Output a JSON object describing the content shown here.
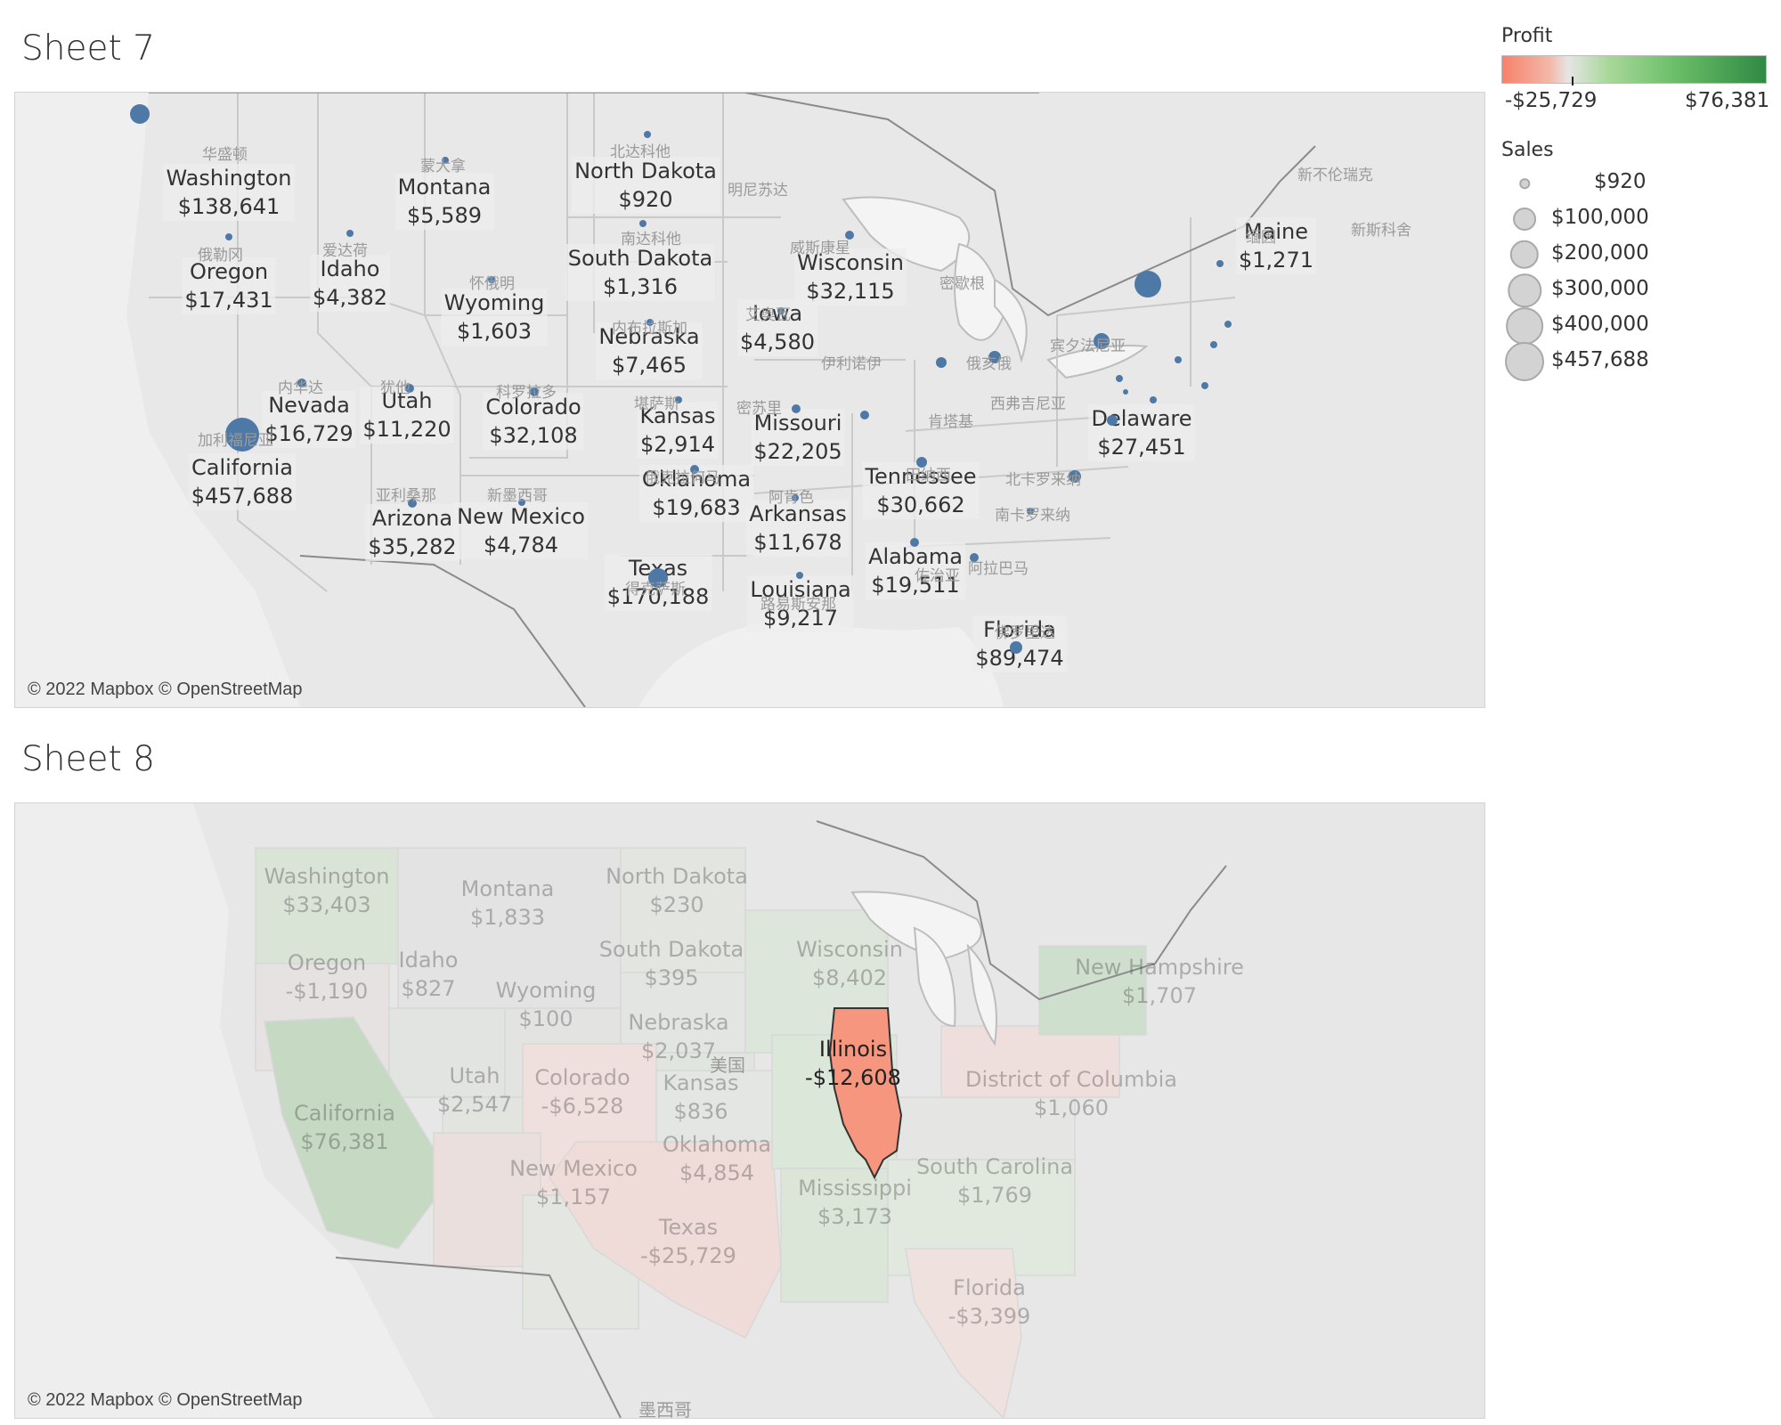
{
  "sheet7": {
    "title": "Sheet 7",
    "attribution": "© 2022 Mapbox © OpenStreetMap",
    "states": [
      {
        "name": "Washington",
        "value": "$138,641"
      },
      {
        "name": "Montana",
        "value": "$5,589"
      },
      {
        "name": "North Dakota",
        "value": "$920"
      },
      {
        "name": "Oregon",
        "value": "$17,431"
      },
      {
        "name": "Idaho",
        "value": "$4,382"
      },
      {
        "name": "South Dakota",
        "value": "$1,316"
      },
      {
        "name": "Wisconsin",
        "value": "$32,115"
      },
      {
        "name": "Maine",
        "value": "$1,271"
      },
      {
        "name": "Wyoming",
        "value": "$1,603"
      },
      {
        "name": "Iowa",
        "value": "$4,580"
      },
      {
        "name": "Nebraska",
        "value": "$7,465"
      },
      {
        "name": "Nevada",
        "value": "$16,729"
      },
      {
        "name": "Utah",
        "value": "$11,220"
      },
      {
        "name": "Colorado",
        "value": "$32,108"
      },
      {
        "name": "Kansas",
        "value": "$2,914"
      },
      {
        "name": "Missouri",
        "value": "$22,205"
      },
      {
        "name": "California",
        "value": "$457,688"
      },
      {
        "name": "Delaware",
        "value": "$27,451"
      },
      {
        "name": "Oklahoma",
        "value": "$19,683"
      },
      {
        "name": "Tennessee",
        "value": "$30,662"
      },
      {
        "name": "Arizona",
        "value": "$35,282"
      },
      {
        "name": "New Mexico",
        "value": "$4,784"
      },
      {
        "name": "Arkansas",
        "value": "$11,678"
      },
      {
        "name": "Alabama",
        "value": "$19,511"
      },
      {
        "name": "Texas",
        "value": "$170,188"
      },
      {
        "name": "Louisiana",
        "value": "$9,217"
      },
      {
        "name": "Florida",
        "value": "$89,474"
      }
    ],
    "cjk_labels": [
      "华盛顿",
      "蒙大拿",
      "北达科他",
      "明尼苏达",
      "俄勒冈",
      "爱达荷",
      "南达科他",
      "威斯康星",
      "密歇根",
      "缅因",
      "怀俄明",
      "艾奥瓦",
      "内布拉斯加",
      "伊利诺伊",
      "俄亥俄",
      "宾夕法尼亚",
      "内华达",
      "犹他",
      "科罗拉多",
      "堪萨斯",
      "密苏里",
      "西弗吉尼亚",
      "肯塔基",
      "加利福尼亚",
      "亚利桑那",
      "新墨西哥",
      "俄克拉何马",
      "阿肯色",
      "田纳西",
      "北卡罗来纳",
      "南卡罗来纳",
      "阿拉巴马",
      "佐治亚",
      "得克萨斯",
      "路易斯安那",
      "佛罗里达",
      "新不伦瑞克",
      "新斯科舍"
    ]
  },
  "sheet8": {
    "title": "Sheet 8",
    "attribution": "© 2022 Mapbox © OpenStreetMap",
    "states": [
      {
        "name": "Washington",
        "value": "$33,403",
        "tone": "pos"
      },
      {
        "name": "Montana",
        "value": "$1,833",
        "tone": "pos"
      },
      {
        "name": "North Dakota",
        "value": "$230",
        "tone": "pos"
      },
      {
        "name": "Oregon",
        "value": "-$1,190",
        "tone": "neg"
      },
      {
        "name": "Idaho",
        "value": "$827",
        "tone": "pos"
      },
      {
        "name": "South Dakota",
        "value": "$395",
        "tone": "pos"
      },
      {
        "name": "Wisconsin",
        "value": "$8,402",
        "tone": "pos"
      },
      {
        "name": "New Hampshire",
        "value": "$1,707",
        "tone": "pos"
      },
      {
        "name": "Wyoming",
        "value": "$100",
        "tone": "pos"
      },
      {
        "name": "Nebraska",
        "value": "$2,037",
        "tone": "pos"
      },
      {
        "name": "Illinois",
        "value": "-$12,608",
        "tone": "neg",
        "highlight": true
      },
      {
        "name": "Utah",
        "value": "$2,547",
        "tone": "pos"
      },
      {
        "name": "Colorado",
        "value": "-$6,528",
        "tone": "neg"
      },
      {
        "name": "Kansas",
        "value": "$836",
        "tone": "pos"
      },
      {
        "name": "District of Columbia",
        "value": "$1,060",
        "tone": "pos"
      },
      {
        "name": "California",
        "value": "$76,381",
        "tone": "pos"
      },
      {
        "name": "Oklahoma",
        "value": "$4,854",
        "tone": "pos"
      },
      {
        "name": "New Mexico",
        "value": "$1,157",
        "tone": "pos"
      },
      {
        "name": "Mississippi",
        "value": "$3,173",
        "tone": "pos"
      },
      {
        "name": "South Carolina",
        "value": "$1,769",
        "tone": "pos"
      },
      {
        "name": "Texas",
        "value": "-$25,729",
        "tone": "neg"
      },
      {
        "name": "Florida",
        "value": "-$3,399",
        "tone": "neg"
      }
    ],
    "country_label_cn": "美国",
    "mexico_label_cn": "墨西哥"
  },
  "legend": {
    "profit_title": "Profit",
    "profit_min": "-$25,729",
    "profit_max": "$76,381",
    "profit_colors": {
      "neg": "#f7816b",
      "mid": "#e5e5e5",
      "pos": "#2f8a44"
    },
    "sales_title": "Sales",
    "sales_sizes": [
      {
        "label": "$920",
        "value": 920
      },
      {
        "label": "$100,000",
        "value": 100000
      },
      {
        "label": "$200,000",
        "value": 200000
      },
      {
        "label": "$300,000",
        "value": 300000
      },
      {
        "label": "$400,000",
        "value": 400000
      },
      {
        "label": "$457,688",
        "value": 457688
      }
    ]
  },
  "colors": {
    "dot": "#4e79a7",
    "map_bg": "#e9e9e9",
    "land": "#dedede",
    "border": "#c4c4c4",
    "illinois": "#f7967f"
  }
}
